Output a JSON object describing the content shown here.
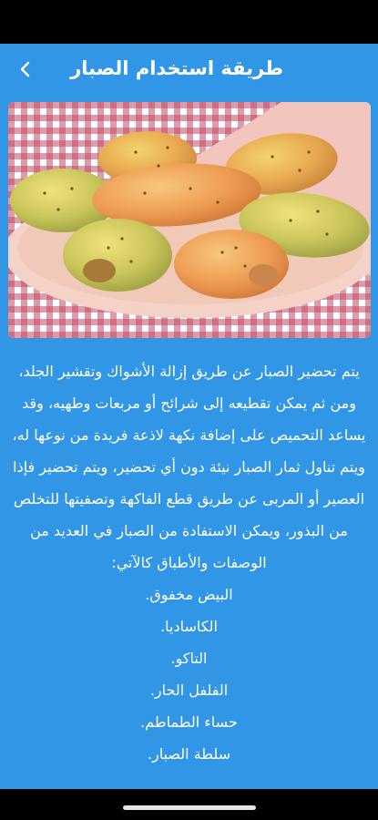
{
  "header": {
    "title": "طريقة استخدام الصبار",
    "back_icon": "chevron-left-icon"
  },
  "image": {
    "subject": "prickly-pear-fruits"
  },
  "article": {
    "paragraph": "يتم تحضير الصبار عن طريق إزالة الأشواك وتقشير الجلد، ومن ثم يمكن تقطيعه إلى شرائح أو مربعات وطهيه، وقد يساعد التحميص على إضافة نكهة لاذعة فريدة من نوعها له، ويتم تناول ثمار الصبار نيئة دون أي تحضير، ويتم تحضير فإذا العصير أو المربى عن طريق قطع الفاكهة وتصفيتها للتخلص من البذور، ويمكن الاستفادة من الصبار في العديد من الوصفات والأطباق كالآتي:",
    "items": [
      "البيض مخفوق.",
      "الكاساديا.",
      "التاكو.",
      "الفلفل الحار.",
      "حساء الطماطم.",
      "سلطة الصبار."
    ]
  },
  "colors": {
    "primary": "#3196e6",
    "text": "#ffffff"
  }
}
